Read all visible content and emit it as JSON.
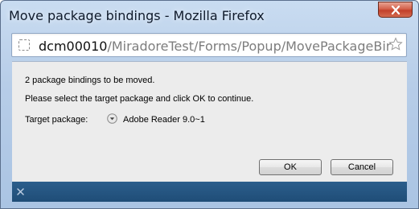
{
  "window": {
    "title": "Move package bindings - Mozilla Firefox"
  },
  "urlbar": {
    "host": "dcm00010",
    "path": "/MiradoreTest/Forms/Popup/MovePackageBindings.as"
  },
  "dialog": {
    "count_message": "2 package bindings to be moved.",
    "instruction": "Please select the target package and click OK to continue.",
    "target_label": "Target package:",
    "target_value": "Adobe Reader 9.0~1",
    "ok_label": "OK",
    "cancel_label": "Cancel"
  },
  "icons": {
    "close": "close-icon",
    "page": "page-icon",
    "bookmark": "star-icon",
    "dropdown": "dropdown-icon",
    "statusbar_close": "close-icon"
  },
  "colors": {
    "statusbar": "#1f4d77",
    "close_button": "#c2402a"
  }
}
